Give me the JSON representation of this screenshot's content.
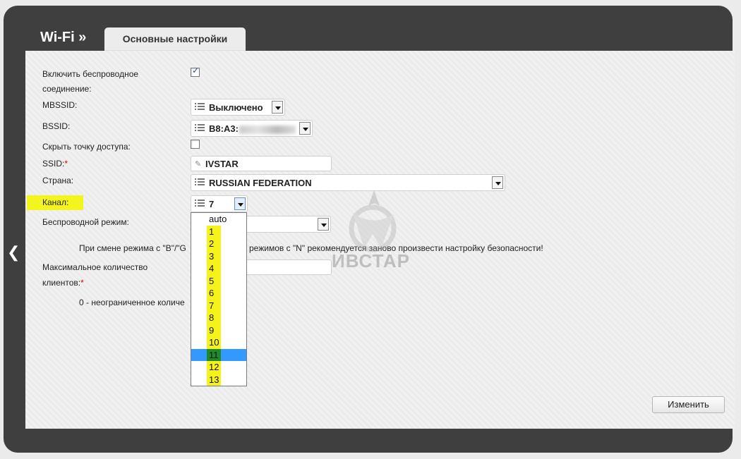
{
  "header": {
    "section": "Wi-Fi »",
    "tab": "Основные настройки"
  },
  "form": {
    "enable_label_line1": "Включить беспроводное",
    "enable_label_line2": "соединение:",
    "enable_checked": true,
    "mbssid_label": "MBSSID:",
    "mbssid_value": "Выключено",
    "bssid_label": "BSSID:",
    "bssid_value": "B8:A3:",
    "hide_ap_label": "Скрыть точку доступа:",
    "hide_ap_checked": false,
    "ssid_label": "SSID:",
    "ssid_required": "*",
    "ssid_value": "IVSTAR",
    "country_label": "Страна:",
    "country_value": "RUSSIAN FEDERATION",
    "channel_label": "Канал:",
    "channel_value": "7",
    "mode_label": "Беспроводной режим:",
    "mode_value": "",
    "notice_left": "При смене режима с \"B\"/\"G",
    "notice_right": "о режимов с \"N\" рекомендуется заново произвести настройку безопасности!",
    "max_clients_line1": "Максимальное количество",
    "max_clients_line2": "клиентов:",
    "max_clients_required": "*",
    "max_clients_hint": "0 - неограниченное количе"
  },
  "channel_options": [
    "auto",
    "1",
    "2",
    "3",
    "4",
    "5",
    "6",
    "7",
    "8",
    "9",
    "10",
    "11",
    "12",
    "13"
  ],
  "channel_highlighted": "11",
  "buttons": {
    "apply": "Изменить"
  },
  "watermark": "ИВСТАР",
  "colors": {
    "frame": "#3f3f3f",
    "highlight": "#f5f51e",
    "selection": "#3399ff"
  }
}
